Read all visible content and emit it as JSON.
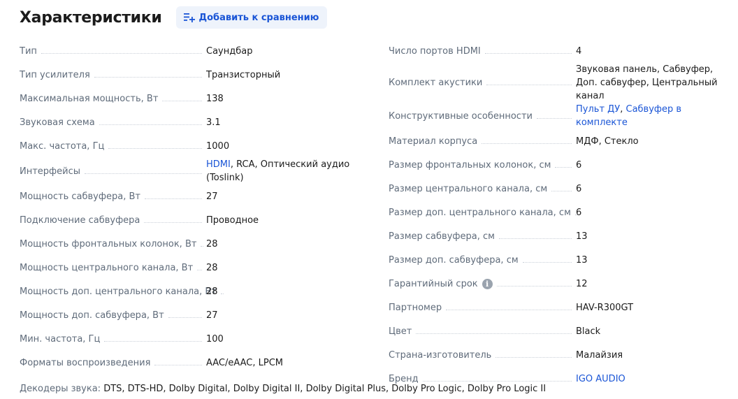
{
  "header": {
    "title": "Характеристики",
    "compare_label": "Добавить к сравнению"
  },
  "left": [
    {
      "key": "Тип",
      "value": "Саундбар"
    },
    {
      "key": "Тип усилителя",
      "value": "Транзисторный"
    },
    {
      "key": "Максимальная мощность, Вт",
      "value": "138"
    },
    {
      "key": "Звуковая схема",
      "value": "3.1"
    },
    {
      "key": "Макс. частота, Гц",
      "value": "1000"
    },
    {
      "key": "Интерфейсы",
      "value_link": "HDMI",
      "value": ", RCA, Оптический аудио (Toslink)"
    },
    {
      "key": "Мощность сабвуфера, Вт",
      "value": "27"
    },
    {
      "key": "Подключение сабвуфера",
      "value": "Проводное"
    },
    {
      "key": "Мощность фронтальных колонок, Вт",
      "value": "28"
    },
    {
      "key": "Мощность центрального канала, Вт",
      "value": "28"
    },
    {
      "key": "Мощность доп. центрального канала, Вт",
      "value": "28"
    },
    {
      "key": "Мощность доп. сабвуфера, Вт",
      "value": "27"
    },
    {
      "key": "Мин. частота, Гц",
      "value": "100"
    },
    {
      "key": "Форматы воспроизведения",
      "value": "AAC/eAAC, LPCM"
    }
  ],
  "right": [
    {
      "key": "Число портов HDMI",
      "value": "4"
    },
    {
      "key": "Комплект акустики",
      "value": "Звуковая панель, Сабвуфер, Доп. сабвуфер, Центральный канал"
    },
    {
      "key": "Конструктивные особенности",
      "value_link": "Пульт ДУ",
      "sep": ", ",
      "value_link2": "Сабвуфер в комплекте"
    },
    {
      "key": "Материал корпуса",
      "value": "МДФ, Стекло"
    },
    {
      "key": "Размер фронтальных колонок, см",
      "value": "6"
    },
    {
      "key": "Размер центрального канала, см",
      "value": "6"
    },
    {
      "key": "Размер доп. центрального канала, см",
      "value": "6"
    },
    {
      "key": "Размер сабвуфера, см",
      "value": "13"
    },
    {
      "key": "Размер доп. сабвуфера, см",
      "value": "13"
    },
    {
      "key": "Гарантийный срок",
      "value": "12",
      "info_icon": "i"
    },
    {
      "key": "Партномер",
      "value": "HAV-R300GT"
    },
    {
      "key": "Цвет",
      "value": "Black"
    },
    {
      "key": "Страна-изготовитель",
      "value": "Малайзия"
    },
    {
      "key": "Бренд",
      "value_link": "IGO AUDIO"
    }
  ],
  "decoders": {
    "key": "Декодеры звука:",
    "value": "DTS, DTS-HD, Dolby Digital, Dolby Digital II, Dolby Digital Plus, Dolby Pro Logic, Dolby Pro Logic II"
  },
  "colors": {
    "link": "#1a55d6",
    "muted": "#5f6b7a",
    "button_bg": "#eef3fb"
  }
}
